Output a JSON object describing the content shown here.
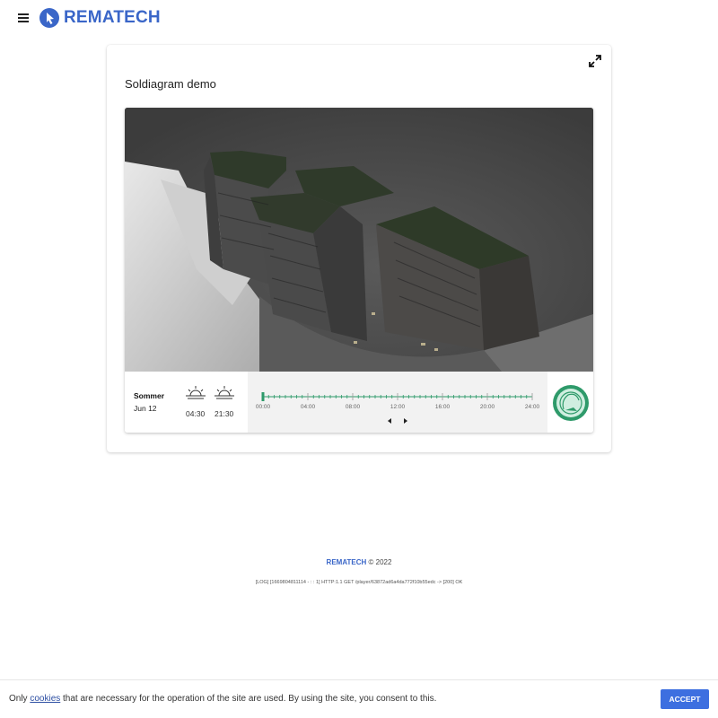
{
  "header": {
    "menu_icon": "hamburger-menu-icon",
    "logo_text": "REMATECH",
    "brand_color": "#3a66c8"
  },
  "card": {
    "title": "Soldiagram demo",
    "expand_icon": "expand-arrows-icon"
  },
  "viewer": {
    "scene_description_icon": "building-3d-render",
    "season": "Sommer",
    "date": "Jun 12",
    "sunrise": {
      "icon": "sunrise-icon",
      "time": "04:30"
    },
    "sunset": {
      "icon": "sunset-icon",
      "time": "21:30"
    },
    "timeline": {
      "labels": [
        "00:00",
        "04:00",
        "08:00",
        "12:00",
        "16:00",
        "20:00",
        "24:00"
      ],
      "current_fraction": 0.0,
      "accent_color": "#2e9a6a"
    },
    "prev_icon": "caret-left-icon",
    "next_icon": "caret-right-icon",
    "compass_icon": "compass-icon"
  },
  "footer": {
    "brand": "REMATECH",
    "copyright": "© 2022",
    "log": "[LOG] [1669804811114 - : : 1] HTTP:1.1 GET /player/63872ad6a4da772f10b55edc -> [200] OK"
  },
  "cookie": {
    "text_before": "Only ",
    "link_text": "cookies",
    "text_after": " that are necessary for the operation of the site are used. By using the site, you consent to this.",
    "button_label": "ACCEPT",
    "button_color": "#3d6fe0"
  }
}
